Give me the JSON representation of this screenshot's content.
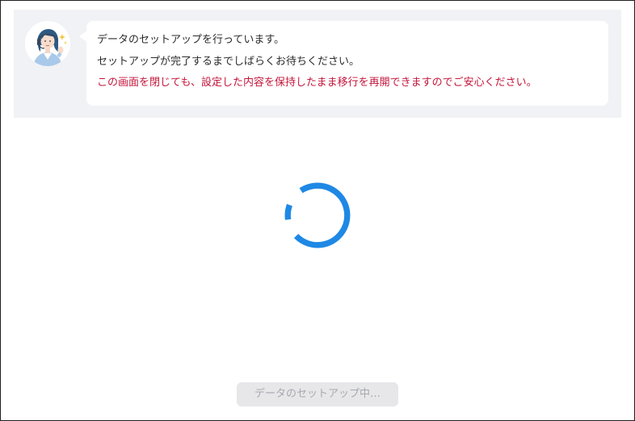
{
  "message": {
    "lines": [
      "データのセットアップを行っています。",
      "セットアップが完了するまでしばらくお待ちください。",
      "この画面を閉じても、設定した内容を保持したまま移行を再開できますのでご安心ください。"
    ],
    "avatar_icon": "support-operator-avatar",
    "notice_color": "#c4163b"
  },
  "spinner": {
    "icon": "loading-spinner",
    "color": "#1e88e5"
  },
  "footer": {
    "button_label": "データのセットアップ中…",
    "button_state": "disabled"
  }
}
